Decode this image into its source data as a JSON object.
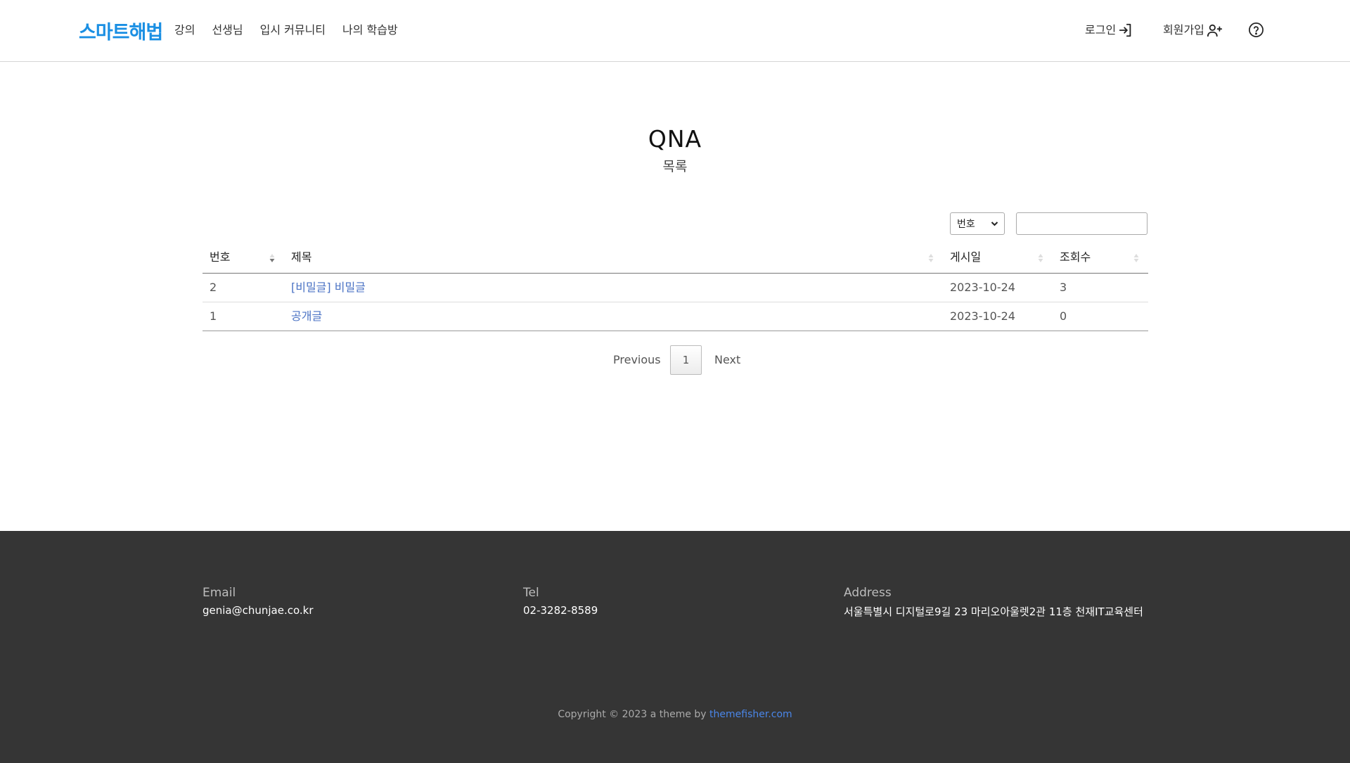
{
  "header": {
    "logo_text": "스마트해법",
    "nav": [
      "강의",
      "선생님",
      "입시 커뮤니티",
      "나의 학습방"
    ],
    "login_label": "로그인",
    "signup_label": "회원가입"
  },
  "page": {
    "title": "QNA",
    "subtitle": "목록"
  },
  "controls": {
    "select_value": "번호",
    "search_value": ""
  },
  "table": {
    "headers": [
      "번호",
      "제목",
      "게시일",
      "조회수"
    ],
    "rows": [
      {
        "no": "2",
        "title": "[비밀글] 비밀글",
        "date": "2023-10-24",
        "views": "3"
      },
      {
        "no": "1",
        "title": "공개글",
        "date": "2023-10-24",
        "views": "0"
      }
    ]
  },
  "pagination": {
    "prev": "Previous",
    "current": "1",
    "next": "Next"
  },
  "footer": {
    "email_label": "Email",
    "email": "genia@chunjae.co.kr",
    "tel_label": "Tel",
    "tel": "02-3282-8589",
    "address_label": "Address",
    "address": "서울특별시 디지털로9길 23 마리오아울렛2관 11층 천재IT교육센터",
    "copyright_prefix": "Copyright © 2023 a theme by ",
    "copyright_link": "themefisher.com"
  },
  "colors": {
    "logo": "#1a8fe3",
    "link": "#4a72c4",
    "footer_bg": "#353535",
    "footer_link": "#4a86e8"
  }
}
